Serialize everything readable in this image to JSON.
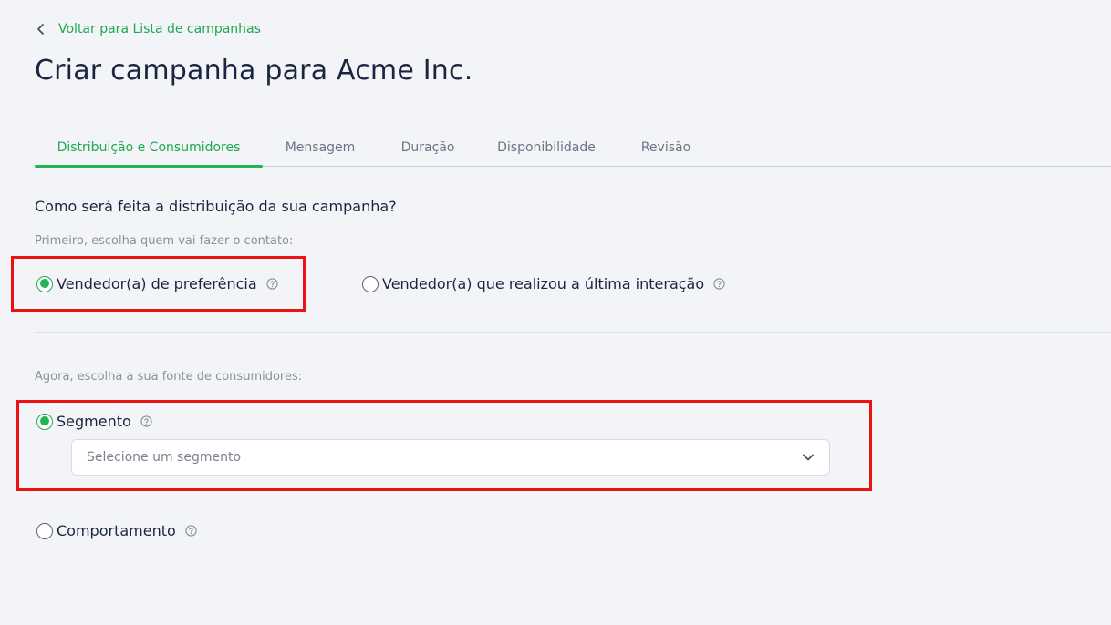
{
  "header": {
    "back_label": "Voltar para Lista de campanhas",
    "title": "Criar campanha para Acme Inc."
  },
  "tabs": [
    {
      "label": "Distribuição e Consumidores",
      "active": true
    },
    {
      "label": "Mensagem",
      "active": false
    },
    {
      "label": "Duração",
      "active": false
    },
    {
      "label": "Disponibilidade",
      "active": false
    },
    {
      "label": "Revisão",
      "active": false
    }
  ],
  "distribution": {
    "question": "Como será feita a distribuição da sua campanha?",
    "hint": "Primeiro, escolha quem vai fazer o contato:",
    "options": [
      {
        "label": "Vendedor(a) de preferência",
        "checked": true
      },
      {
        "label": "Vendedor(a) que realizou a última interação",
        "checked": false
      }
    ]
  },
  "consumers": {
    "hint": "Agora, escolha a sua fonte de consumidores:",
    "options": [
      {
        "label": "Segmento",
        "checked": true
      },
      {
        "label": "Comportamento",
        "checked": false
      }
    ],
    "segment_select": {
      "placeholder": "Selecione um segmento"
    }
  },
  "colors": {
    "accent": "#22b357",
    "highlight": "#ee1111",
    "background": "#f3f4f8"
  },
  "icons": {
    "back": "chevron-left-icon",
    "help": "question-circle-icon",
    "dropdown": "chevron-down-icon"
  }
}
